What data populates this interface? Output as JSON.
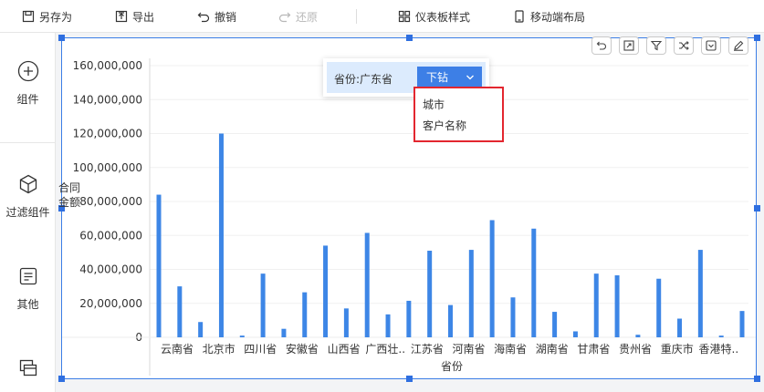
{
  "toolbar": {
    "save_as": "另存为",
    "export": "导出",
    "undo": "撤销",
    "redo": "还原",
    "dashboard_style": "仪表板样式",
    "mobile_layout": "移动端布局"
  },
  "sidebar": {
    "items": [
      {
        "label": "组件",
        "icon": "plus-circle-icon"
      },
      {
        "label": "过滤组件",
        "icon": "cube-icon"
      },
      {
        "label": "其他",
        "icon": "document-icon"
      },
      {
        "label": "",
        "icon": "layers-icon"
      }
    ]
  },
  "widget_tools": [
    "undo-icon",
    "expand-icon",
    "filter-icon",
    "shuffle-icon",
    "collapse-icon",
    "edit-icon"
  ],
  "drill": {
    "label": "省份:广东省",
    "button_label": "下钻",
    "options": [
      "城市",
      "客户名称"
    ]
  },
  "colors": {
    "bar": "#3d86e6",
    "accent": "#2f6fe0",
    "highlight_border": "#e3262f"
  },
  "chart_data": {
    "type": "bar",
    "xlabel": "省份",
    "ylabel": "合同金额",
    "ylim": [
      0,
      160000000
    ],
    "y_ticks": [
      "0",
      "20,000,000",
      "40,000,000",
      "60,000,000",
      "80,000,000",
      "100,000,000",
      "120,000,000",
      "140,000,000",
      "160,000,000"
    ],
    "tick_labels": [
      "云南省",
      "北京市",
      "四川省",
      "安徽省",
      "山西省",
      "广西壮..",
      "江苏省",
      "河南省",
      "海南省",
      "湖南省",
      "甘肃省",
      "贵州省",
      "重庆市",
      "香港特.."
    ],
    "values": [
      84000000,
      30000000,
      9000000,
      120000000,
      1000000,
      37500000,
      5000000,
      26500000,
      54000000,
      17000000,
      61500000,
      13500000,
      21500000,
      51000000,
      19000000,
      51500000,
      69000000,
      23500000,
      64000000,
      15000000,
      3500000,
      37500000,
      36500000,
      1500000,
      34500000,
      11000000,
      51500000,
      1000000,
      15500000
    ]
  }
}
